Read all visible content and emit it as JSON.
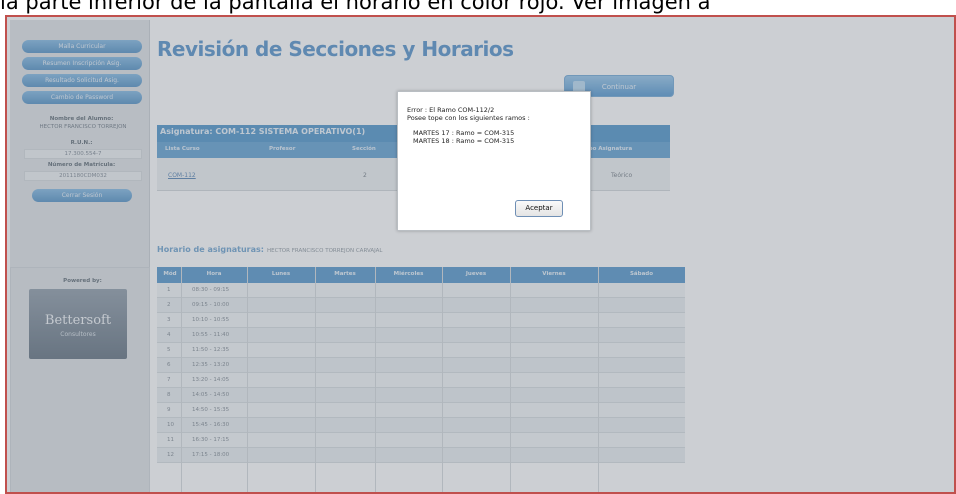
{
  "caption": "la parte inferior de la pantalla el horario en color rojo. Ver imagen a",
  "sidebar": {
    "buttons": [
      "Malla Curricular",
      "Resumen Inscripción Asig.",
      "Resultado Solicitud Asig.",
      "Cambio de Password"
    ],
    "student_name_label": "Nombre del Alumno:",
    "student_name": "HECTOR FRANCISCO TORREJON",
    "rut_label": "R.U.N.:",
    "rut_value": "17.300.554-7",
    "matricula_label": "Número de Matrícula:",
    "matricula_value": "2011180CDM032",
    "logout_button": "Cerrar Sesión",
    "powered_by": "Powered by:",
    "logo_name": "Bettersoft",
    "logo_sub": "Consultores"
  },
  "page": {
    "title": "Revisión de Secciones y Horarios",
    "continue_button": "Continuar"
  },
  "asignaturas": {
    "title": "Asignatura: COM-112 SISTEMA OPERATIVO(1)",
    "columns": [
      "Lista Curso",
      "Profesor",
      "Sección",
      "Tipo Asignatura"
    ],
    "row": {
      "curso": "COM-112",
      "seccion": "2",
      "tipo": "Teórico"
    }
  },
  "horario": {
    "title": "Horario de asignaturas:",
    "student": "HECTOR FRANCISCO TORREJON CARVAJAL",
    "columns": [
      "Mód",
      "Hora",
      "Lunes",
      "Martes",
      "Miércoles",
      "Jueves",
      "Viernes",
      "Sábado"
    ],
    "rows": [
      {
        "mod": "1",
        "hora": "08:30 - 09:15"
      },
      {
        "mod": "2",
        "hora": "09:15 - 10:00"
      },
      {
        "mod": "3",
        "hora": "10:10 - 10:55"
      },
      {
        "mod": "4",
        "hora": "10:55 - 11:40"
      },
      {
        "mod": "5",
        "hora": "11:50 - 12:35"
      },
      {
        "mod": "6",
        "hora": "12:35 - 13:20"
      },
      {
        "mod": "7",
        "hora": "13:20 - 14:05"
      },
      {
        "mod": "8",
        "hora": "14:05 - 14:50"
      },
      {
        "mod": "9",
        "hora": "14:50 - 15:35"
      },
      {
        "mod": "10",
        "hora": "15:45 - 16:30"
      },
      {
        "mod": "11",
        "hora": "16:30 - 17:15"
      },
      {
        "mod": "12",
        "hora": "17:15 - 18:00"
      }
    ]
  },
  "dialog": {
    "line1": "Error : El Ramo COM-112/2",
    "line2": "Posee tope con los siguientes ramos :",
    "line3": "MARTES 17 : Ramo = COM-315",
    "line4": "MARTES 18 : Ramo = COM-315",
    "ok_button": "Aceptar"
  },
  "colors": {
    "accent": "#4f8ec9",
    "frame_border": "#c0504d"
  }
}
